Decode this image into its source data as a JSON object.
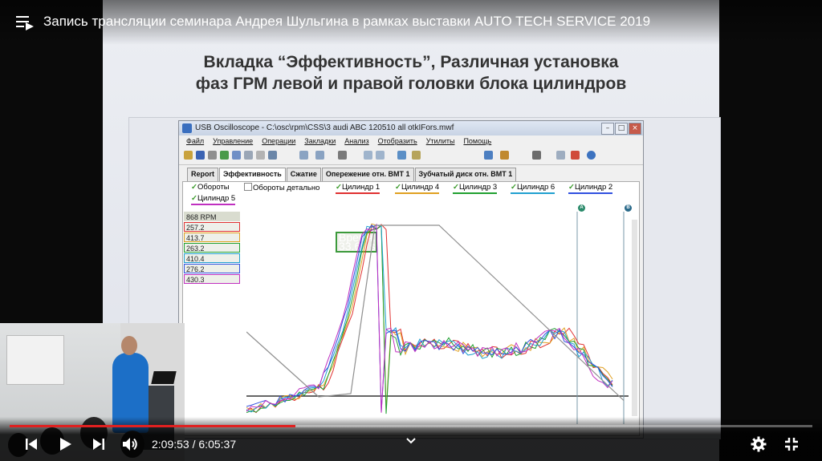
{
  "video": {
    "title": "Запись трансляции семинара Андрея Шульгина в рамках выставки AUTO TECH SERVICE 2019",
    "time_current": "2:09:53",
    "time_separator": " / ",
    "time_total": "6:05:37",
    "progress_fraction": 0.356,
    "accent_color": "#e02020"
  },
  "slide": {
    "title_line1": "Вкладка “Эффективность”, Различная установка",
    "title_line2": "фаз ГРМ левой и правой головки блока цилиндров"
  },
  "app": {
    "window_title": "USB Oscilloscope - C:\\osc\\rpm\\CSS\\3 audi ABC 120510  all otkIFors.mwf",
    "menu": [
      "Файл",
      "Управление",
      "Операции",
      "Закладки",
      "Анализ",
      "Отобразить",
      "Утилиты",
      "Помощь"
    ],
    "tabs": [
      "Report",
      "Эффективность",
      "Сжатие",
      "Опережение отн. ВМТ 1",
      "Зубчатый диск отн. ВМТ 1"
    ],
    "active_tab": "Эффективность",
    "legend": [
      {
        "label": "Обороты",
        "checked": true,
        "color": "#444444"
      },
      {
        "label": "Обороты детально",
        "checked": false,
        "color": "#444444"
      },
      {
        "label": "Цилиндр 1",
        "checked": true,
        "color": "#e03030"
      },
      {
        "label": "Цилиндр 4",
        "checked": true,
        "color": "#e0a020"
      },
      {
        "label": "Цилиндр 3",
        "checked": true,
        "color": "#20a030"
      },
      {
        "label": "Цилиндр 6",
        "checked": true,
        "color": "#20a0d0"
      },
      {
        "label": "Цилиндр 2",
        "checked": true,
        "color": "#3050e0"
      },
      {
        "label": "Цилиндр 5",
        "checked": true,
        "color": "#c030c0"
      }
    ],
    "readouts": {
      "time_label": "Время:",
      "time_value": "33.68 s",
      "rpm": "868 RPM",
      "cyl_values": [
        {
          "value": "257.2",
          "color": "#e03030"
        },
        {
          "value": "413.7",
          "color": "#e0a020"
        },
        {
          "value": "263.2",
          "color": "#20a030"
        },
        {
          "value": "410.4",
          "color": "#20a0d0"
        },
        {
          "value": "276.2",
          "color": "#3050e0"
        },
        {
          "value": "430.3",
          "color": "#c030c0"
        }
      ]
    },
    "markers": [
      "A",
      "B"
    ]
  },
  "icons": {
    "playlist": "playlist-icon",
    "prev": "previous-icon",
    "play": "play-icon",
    "next": "next-icon",
    "volume": "volume-icon",
    "chevron": "chevron-down-icon",
    "settings": "settings-icon",
    "fullscreen_exit": "exit-fullscreen-icon"
  }
}
